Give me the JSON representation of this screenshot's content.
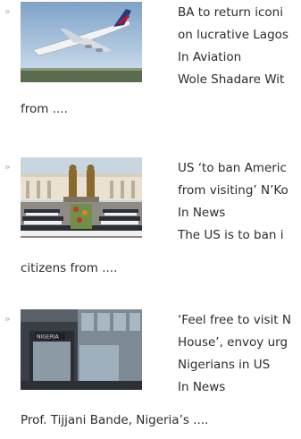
{
  "bullet_glyph": "»",
  "items": [
    {
      "title_lines": [
        "BA to return iconi",
        "on lucrative Lagos"
      ],
      "category": "In Aviation",
      "excerpt_line": "Wole Shadare Wit",
      "excerpt_tail": "from ....",
      "thumb_alt": "British Airways aircraft"
    },
    {
      "title_lines": [
        "US ‘to ban Americ",
        "from visiting’ N’Ko"
      ],
      "category": "In News",
      "excerpt_line": "The US is to ban i",
      "excerpt_tail": "citizens from ....",
      "thumb_alt": "Crowd at monument statues"
    },
    {
      "title_lines": [
        "‘Feel free to visit N",
        "House’, envoy urg",
        "Nigerians in US"
      ],
      "category": "In News",
      "excerpt_line": "",
      "excerpt_tail": "Prof. Tijjani Bande, Nigeria’s ....",
      "thumb_alt": "Nigeria House building entrance"
    }
  ]
}
